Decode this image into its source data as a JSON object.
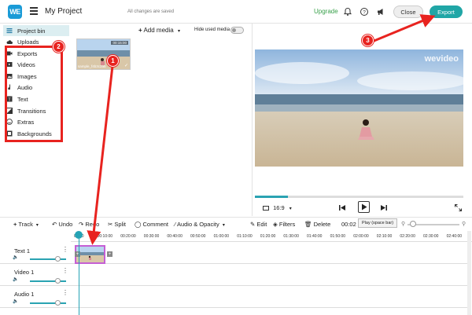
{
  "header": {
    "logo": "WE",
    "title": "My Project",
    "save_status": "All changes are saved",
    "upgrade_label": "Upgrade",
    "close_label": "Close",
    "export_label": "Export",
    "icons": [
      "bell-icon",
      "help-icon",
      "announcement-icon"
    ]
  },
  "sidebar": {
    "items": [
      {
        "label": "Project bin",
        "icon": "layers-icon",
        "active": true
      },
      {
        "label": "Uploads",
        "icon": "cloud-upload-icon"
      },
      {
        "label": "Exports",
        "icon": "film-icon"
      },
      {
        "label": "Videos",
        "icon": "video-icon"
      },
      {
        "label": "Images",
        "icon": "image-icon"
      },
      {
        "label": "Audio",
        "icon": "music-note-icon"
      },
      {
        "label": "Text",
        "icon": "text-icon"
      },
      {
        "label": "Transitions",
        "icon": "transition-icon"
      },
      {
        "label": "Extras",
        "icon": "smiley-icon"
      },
      {
        "label": "Backgrounds",
        "icon": "backgrounds-icon"
      }
    ]
  },
  "media": {
    "add_media_label": "Add media",
    "hide_used_label": "Hide used media",
    "clip": {
      "duration": "00:15:00",
      "name": "sample_f4b3c2a5"
    }
  },
  "preview": {
    "watermark": "wevideo",
    "progress": 0.16,
    "aspect_ratio": "16:9",
    "play_tooltip": "Play (space bar)"
  },
  "timeline_toolbar": {
    "track_label": "Track",
    "undo_label": "Undo",
    "redo_label": "Redo",
    "split_label": "Split",
    "comment_label": "Comment",
    "audio_opacity_label": "Audio & Opacity",
    "edit_label": "Edit",
    "filters_label": "Filters",
    "delete_label": "Delete",
    "time_readout": "00:02"
  },
  "ruler": {
    "ticks": [
      "00:00",
      "00:10:00",
      "00:20:00",
      "00:30:00",
      "00:40:00",
      "00:50:00",
      "01:00:00",
      "01:10:00",
      "01:20:00",
      "01:30:00",
      "01:40:00",
      "01:50:00",
      "02:00:00",
      "02:10:00",
      "02:20:00",
      "02:30:00",
      "02:40:00"
    ]
  },
  "tracks": [
    {
      "label": "Text 1",
      "volume": 0.75
    },
    {
      "label": "Video 1",
      "volume": 0.75
    },
    {
      "label": "Audio 1",
      "volume": 0.75
    }
  ],
  "annotations": {
    "badge_1": "1",
    "badge_2": "2",
    "badge_3": "3",
    "color": "#e8231f"
  },
  "colors": {
    "accent": "#20a6a6",
    "upgrade": "#3aa14c",
    "playhead": "#25a3b5",
    "clip_border": "#c55fd4"
  }
}
